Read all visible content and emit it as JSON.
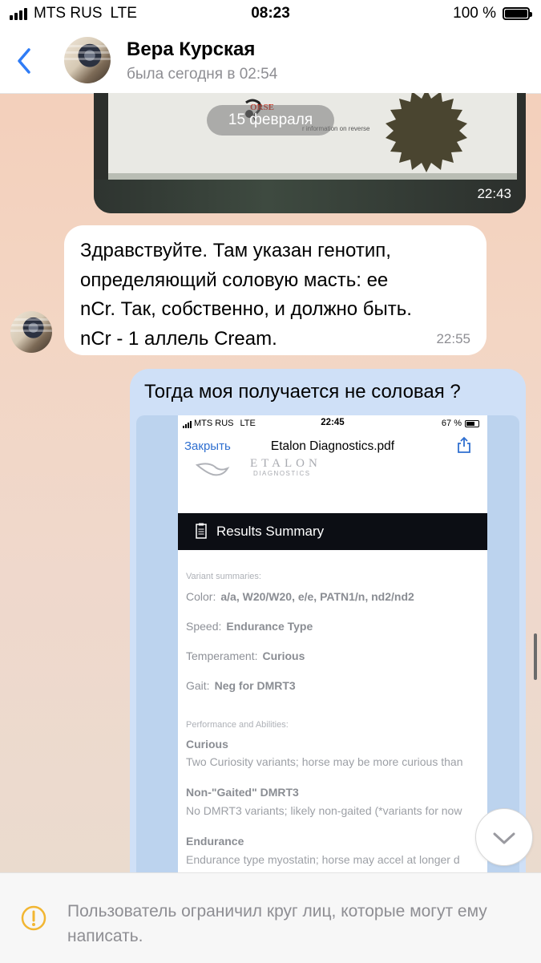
{
  "status_bar": {
    "carrier": "MTS RUS",
    "network": "LTE",
    "time": "08:23",
    "battery": "100 %"
  },
  "header": {
    "back_icon": "chevron-left-icon",
    "name": "Вера Курская",
    "status": "была сегодня в 02:54"
  },
  "chat": {
    "date_label": "15 февраля",
    "photo_message": {
      "time": "22:43",
      "visible_text": {
        "stamp": "ORSE",
        "note": "r information on reverse"
      }
    },
    "incoming_message": {
      "text": "Здравствуйте. Там указан генотип,\nопределяющий соловую масть: ее\nnCr. Так, собственно, и должно быть.\nnCr - 1 аллель Cream.",
      "time": "22:55"
    },
    "outgoing_message": {
      "text": "Тогда моя получается не соловая ?",
      "screenshot": {
        "status_bar": {
          "carrier": "MTS RUS",
          "network": "LTE",
          "time": "22:45",
          "battery": "67 %"
        },
        "close_label": "Закрыть",
        "doc_title": "Etalon Diagnostics.pdf",
        "logo": {
          "name": "ETALON",
          "sub": "DIAGNOSTICS"
        },
        "section_title": "Results Summary",
        "variant_heading": "Variant summaries:",
        "variants": [
          {
            "label": "Color:",
            "value": "a/a, W20/W20, e/e, PATN1/n, nd2/nd2"
          },
          {
            "label": "Speed:",
            "value": "Endurance Type"
          },
          {
            "label": "Temperament:",
            "value": "Curious"
          },
          {
            "label": "Gait:",
            "value": "Neg for DMRT3"
          }
        ],
        "performance_heading": "Performance and Abilities:",
        "abilities": [
          {
            "title": "Curious",
            "desc": "Two Curiosity variants; horse may be more curious than"
          },
          {
            "title": "Non-\"Gaited\" DMRT3",
            "desc": "No DMRT3 variants; likely non-gaited (*variants for now"
          },
          {
            "title": "Endurance",
            "desc": "Endurance type myostatin; horse may accel at longer d"
          }
        ]
      }
    }
  },
  "footer": {
    "icon": "warning-icon",
    "text": "Пользователь ограничил круг лиц, которые могут ему написать."
  },
  "colors": {
    "accent": "#2f7cf6",
    "outgoing_bubble": "#cfe0f7",
    "warning": "#f2b632"
  }
}
